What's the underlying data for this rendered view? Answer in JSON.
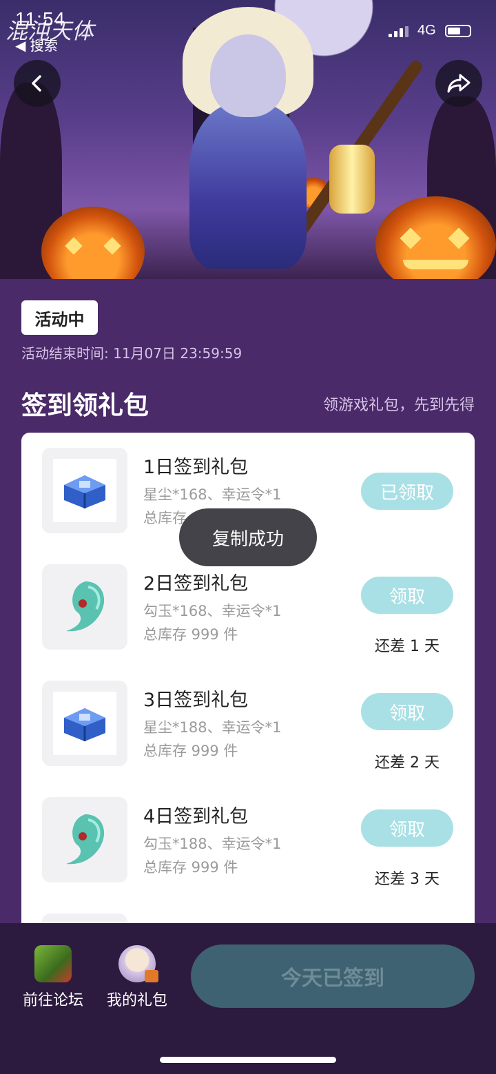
{
  "status": {
    "time": "11:54",
    "back_label": "◀ 搜索",
    "network": "4G"
  },
  "hero": {
    "game_logo": "混沌天体"
  },
  "activity": {
    "badge": "活动中",
    "end_time": "活动结束时间: 11月07日 23:59:59"
  },
  "section": {
    "title": "签到领礼包",
    "subtitle": "领游戏礼包，先到先得"
  },
  "gifts": [
    {
      "name": "1日签到礼包",
      "desc": "星尘*168、幸运令*1",
      "stock": "总库存 999 件",
      "button": "已领取",
      "remaining": "",
      "icon": "blue-chest-icon"
    },
    {
      "name": "2日签到礼包",
      "desc": "勾玉*168、幸运令*1",
      "stock": "总库存 999 件",
      "button": "领取",
      "remaining": "还差 1 天",
      "icon": "jade-magatama-icon"
    },
    {
      "name": "3日签到礼包",
      "desc": "星尘*188、幸运令*1",
      "stock": "总库存 999 件",
      "button": "领取",
      "remaining": "还差 2 天",
      "icon": "blue-chest-icon"
    },
    {
      "name": "4日签到礼包",
      "desc": "勾玉*188、幸运令*1",
      "stock": "总库存 999 件",
      "button": "领取",
      "remaining": "还差 3 天",
      "icon": "jade-magatama-icon"
    }
  ],
  "toast": "复制成功",
  "bottom": {
    "forum_label": "前往论坛",
    "my_gifts_label": "我的礼包",
    "signed_label": "今天已签到"
  },
  "colors": {
    "page_bg": "#4a2a68",
    "claim_button": "#a8e0e5",
    "signed_button": "#3e6271"
  }
}
